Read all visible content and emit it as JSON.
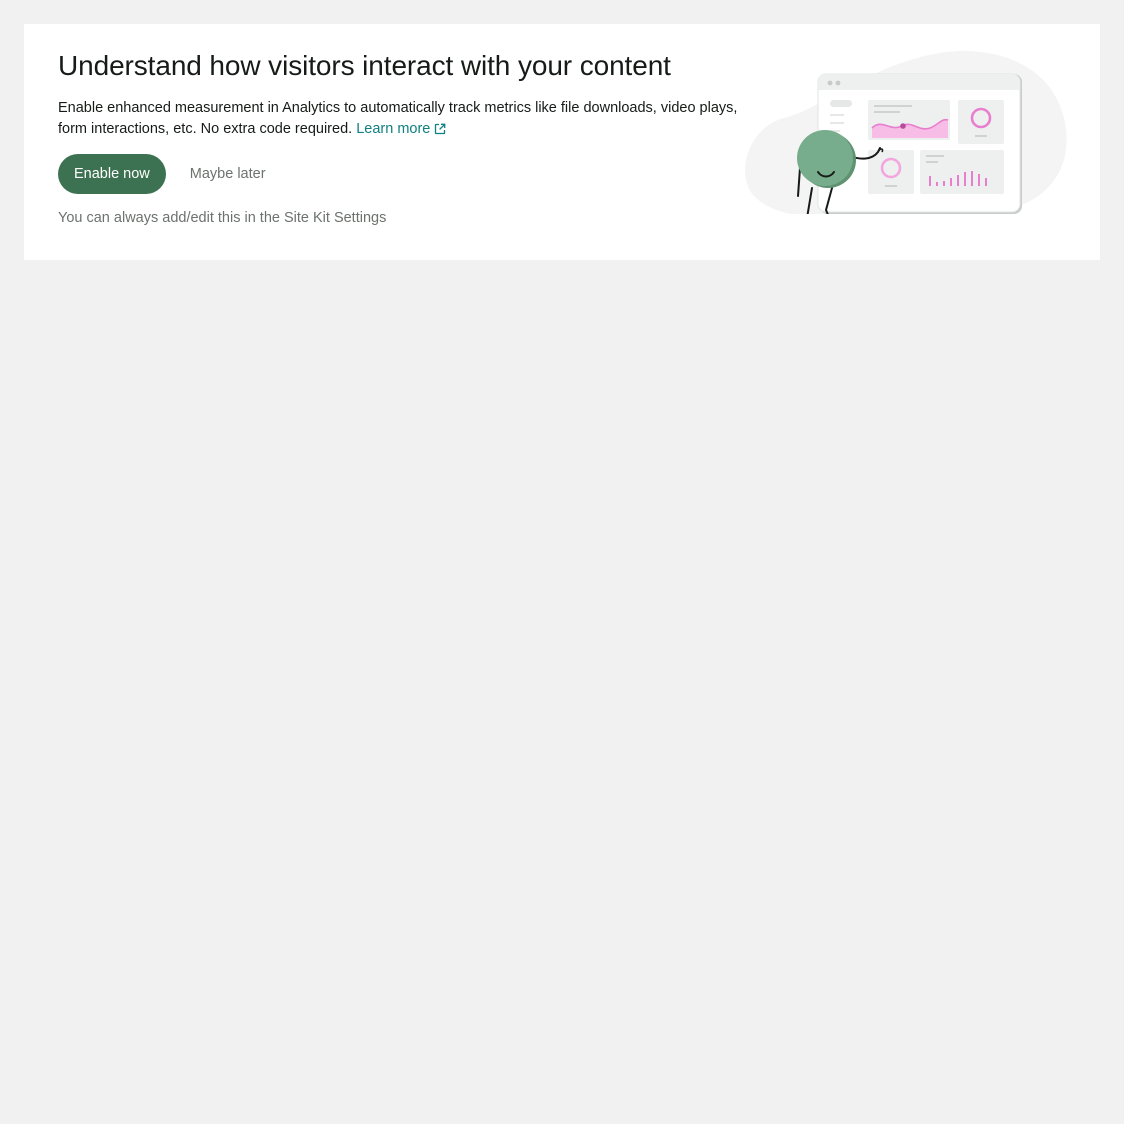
{
  "banner": {
    "title": "Understand how visitors interact with your content",
    "description": "Enable enhanced measurement in Analytics to automatically track metrics like file downloads, video plays, form interactions, etc. No extra code required.",
    "learn_more_label": "Learn more",
    "learn_more_icon": "external-link-icon",
    "primary_button_label": "Enable now",
    "secondary_button_label": "Maybe later",
    "footnote": "You can always add/edit this in the Site Kit Settings"
  },
  "colors": {
    "page_background": "#f1f1f1",
    "card_background": "#ffffff",
    "primary_button": "#3c7251",
    "link": "#108080",
    "muted_text": "#6c726e",
    "illustration_character": "#77ad8c",
    "illustration_accent": "#e77ece"
  }
}
